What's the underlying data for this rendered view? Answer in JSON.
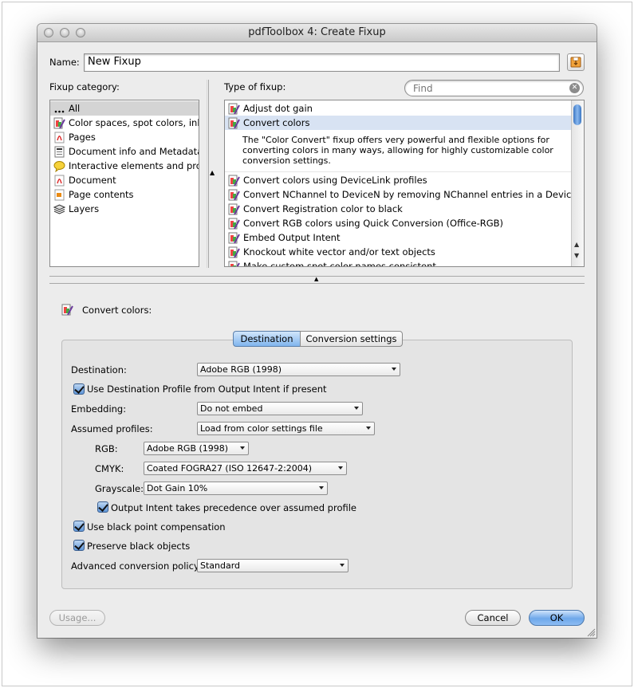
{
  "window": {
    "title": "pdfToolbox 4: Create Fixup"
  },
  "name": {
    "label": "Name:",
    "value": "New Fixup"
  },
  "category": {
    "label": "Fixup category:",
    "items": [
      {
        "label": "All",
        "icon": "ellipsis-icon"
      },
      {
        "label": "Color spaces, spot colors, inks",
        "icon": "color-fixup-icon"
      },
      {
        "label": "Pages",
        "icon": "pdf-page-icon"
      },
      {
        "label": "Document info and Metadata",
        "icon": "document-info-icon"
      },
      {
        "label": "Interactive elements and prope",
        "icon": "speech-bubble-icon"
      },
      {
        "label": "Document",
        "icon": "pdf-document-icon"
      },
      {
        "label": "Page contents",
        "icon": "page-contents-icon"
      },
      {
        "label": "Layers",
        "icon": "layers-icon"
      }
    ]
  },
  "type_of_fixup": {
    "label": "Type of fixup:",
    "search_placeholder": "Find",
    "items": [
      {
        "label": "Adjust dot gain"
      },
      {
        "label": "Convert colors"
      },
      {
        "label": "Convert colors using DeviceLink profiles"
      },
      {
        "label": "Convert NChannel to DeviceN by removing NChannel entries in a DeviceN col"
      },
      {
        "label": "Convert Registration color to black"
      },
      {
        "label": "Convert RGB colors using Quick Conversion (Office-RGB)"
      },
      {
        "label": "Embed Output Intent"
      },
      {
        "label": "Knockout white vector and/or text objects"
      },
      {
        "label": "Make custom spot color names consistent"
      }
    ],
    "description": "The \"Color Convert\" fixup offers very powerful and flexible options for converting colors in many ways, allowing for highly customizable color conversion settings."
  },
  "detail": {
    "heading": "Convert colors:",
    "tabs": [
      "Destination",
      "Conversion settings"
    ],
    "destination_label": "Destination:",
    "destination_value": "Adobe RGB (1998)",
    "use_dest_profile_label": "Use Destination Profile from Output Intent if present",
    "embedding_label": "Embedding:",
    "embedding_value": "Do not embed",
    "assumed_profiles_label": "Assumed profiles:",
    "assumed_profiles_value": "Load from color settings file",
    "rgb_label": "RGB:",
    "rgb_value": "Adobe RGB (1998)",
    "cmyk_label": "CMYK:",
    "cmyk_value": "Coated FOGRA27 (ISO 12647-2:2004)",
    "grayscale_label": "Grayscale:",
    "grayscale_value": "Dot Gain 10%",
    "output_intent_label": "Output Intent takes precedence over assumed profile",
    "black_point_label": "Use black point compensation",
    "preserve_black_label": "Preserve black objects",
    "policy_label": "Advanced conversion policy:",
    "policy_value": "Standard"
  },
  "buttons": {
    "usage": "Usage...",
    "cancel": "Cancel",
    "ok": "OK"
  }
}
